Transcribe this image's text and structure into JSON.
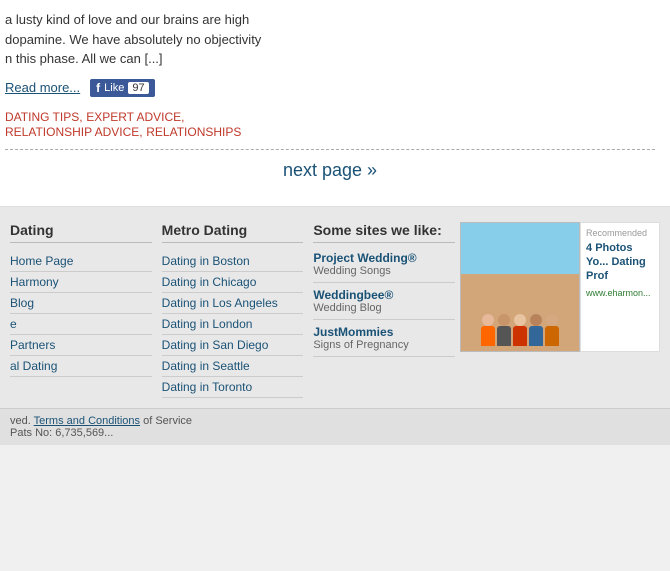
{
  "main": {
    "article": {
      "text_line1": "a lusty kind of love and our brains are high",
      "text_line2": "dopamine. We have absolutely no objectivity",
      "text_line3": "n this phase. All we can [...]",
      "read_more_label": "Read more...",
      "like_label": "Like",
      "like_count": "97",
      "tags": [
        "DATING TIPS",
        "EXPERT ADVICE",
        "RELATIONSHIP ADVICE",
        "RELATIONSHIPS"
      ],
      "next_page_label": "next page »"
    }
  },
  "footer": {
    "dating_col": {
      "title": "Dating",
      "links": [
        "Home Page",
        "Harmony",
        "Blog",
        "e",
        "Partners",
        "al Dating"
      ]
    },
    "metro_col": {
      "title": "Metro Dating",
      "links": [
        "Dating in Boston",
        "Dating in Chicago",
        "Dating in Los Angeles",
        "Dating in London",
        "Dating in San Diego",
        "Dating in Seattle",
        "Dating in Toronto"
      ]
    },
    "sites_col": {
      "title": "Some sites we like:",
      "sites": [
        {
          "name": "Project Wedding®",
          "desc": "Wedding Songs"
        },
        {
          "name": "Weddingbee®",
          "desc": "Wedding Blog"
        },
        {
          "name": "JustMommies",
          "desc": "Signs of Pregnancy"
        }
      ]
    },
    "ad": {
      "recommended_label": "Recommended",
      "title": "4 Photos Yo... Dating Prof",
      "url": "www.eharmon..."
    },
    "bottom_bar": {
      "reserved_text": "ved.",
      "terms_label": "Terms and Conditions",
      "service_text": "of Service",
      "phone_prefix": "Pats No: 6,735,569..."
    }
  }
}
